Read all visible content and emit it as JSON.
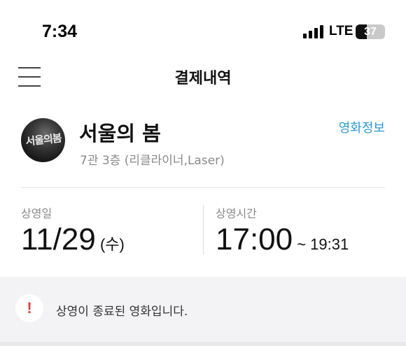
{
  "status_bar": {
    "time": "7:34",
    "network": "LTE",
    "battery_level": "37",
    "battery_fill_fraction": 0.37
  },
  "header": {
    "title": "결제내역",
    "menu_icon": "hamburger-menu-icon"
  },
  "movie": {
    "poster_text": "서울의봄",
    "title": "서울의 봄",
    "subtitle": "7관 3층 (리클라이너,Laser)",
    "info_link": "영화정보",
    "accent_color": "#2a9bd6"
  },
  "showtime": {
    "date_label": "상영일",
    "date": "11/29",
    "weekday": " (수)",
    "time_label": "상영시간",
    "start_time": "17:00",
    "end_time": " ~ 19:31"
  },
  "notice": {
    "icon": "exclamation-icon",
    "icon_color": "#e8393a",
    "text": "상영이 종료된 영화입니다."
  }
}
